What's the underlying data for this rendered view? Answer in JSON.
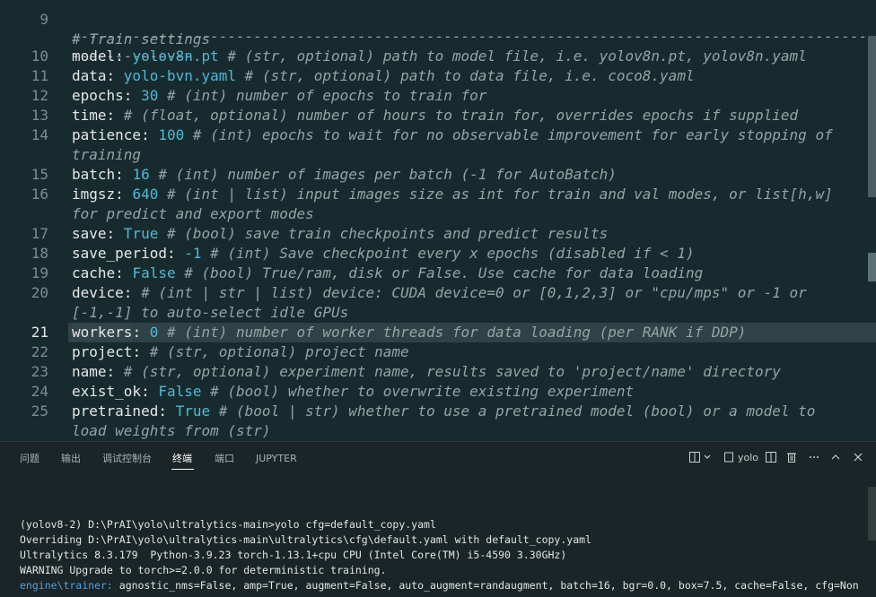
{
  "editor": {
    "top_comment": "# Train settings",
    "divider": "--------------------------------------------------------------------------------------------",
    "divider_wrap": "--------------",
    "lines": [
      {
        "num": "10",
        "key": "model",
        "value": "yolov8n.pt",
        "comment": "# (str, optional) path to model file, i.e. yolov8n.pt, yolov8n.yaml"
      },
      {
        "num": "11",
        "key": "data",
        "value": "yolo-bvn.yaml",
        "comment": "# (str, optional) path to data file, i.e. coco8.yaml"
      },
      {
        "num": "12",
        "key": "epochs",
        "value": "30",
        "comment": "# (int) number of epochs to train for"
      },
      {
        "num": "13",
        "key": "time",
        "value": "",
        "comment": "# (float, optional) number of hours to train for, overrides epochs if supplied"
      },
      {
        "num": "14",
        "key": "patience",
        "value": "100",
        "comment": "# (int) epochs to wait for no observable improvement for early stopping of",
        "wrap": "training"
      },
      {
        "num": "15",
        "key": "batch",
        "value": "16",
        "comment": "# (int) number of images per batch (-1 for AutoBatch)"
      },
      {
        "num": "16",
        "key": "imgsz",
        "value": "640",
        "comment": "# (int | list) input images size as int for train and val modes, or list[h,w]",
        "wrap": "for predict and export modes"
      },
      {
        "num": "17",
        "key": "save",
        "value": "True",
        "comment": "# (bool) save train checkpoints and predict results"
      },
      {
        "num": "18",
        "key": "save_period",
        "value": "-1",
        "comment": "# (int) Save checkpoint every x epochs (disabled if < 1)"
      },
      {
        "num": "19",
        "key": "cache",
        "value": "False",
        "comment": "# (bool) True/ram, disk or False. Use cache for data loading"
      },
      {
        "num": "20",
        "key": "device",
        "value": "",
        "comment": "# (int | str | list) device: CUDA device=0 or [0,1,2,3] or \"cpu/mps\" or -1 or",
        "wrap": "[-1,-1] to auto-select idle GPUs"
      },
      {
        "num": "21",
        "key": "workers",
        "value": "0",
        "comment": "# (int) number of worker threads for data loading (per RANK if DDP)"
      },
      {
        "num": "22",
        "key": "project",
        "value": "",
        "comment": "# (str, optional) project name"
      },
      {
        "num": "23",
        "key": "name",
        "value": "",
        "comment": "# (str, optional) experiment name, results saved to 'project/name' directory"
      },
      {
        "num": "24",
        "key": "exist_ok",
        "value": "False",
        "comment": "# (bool) whether to overwrite existing experiment"
      },
      {
        "num": "25",
        "key": "pretrained",
        "value": "True",
        "comment": "# (bool | str) whether to use a pretrained model (bool) or a model to",
        "wrap": "load weights from (str)"
      }
    ]
  },
  "panel": {
    "tabs": [
      "问题",
      "输出",
      "调试控制台",
      "终端",
      "端口",
      "JUPYTER"
    ],
    "terminal_name": "yolo",
    "terminal_lines": [
      {
        "prefix": "",
        "text": "(yolov8-2) D:\\PrAI\\yolo\\ultralytics-main>yolo cfg=default_copy.yaml"
      },
      {
        "prefix": "",
        "text": "Overriding D:\\PrAI\\yolo\\ultralytics-main\\ultralytics\\cfg\\default.yaml with default_copy.yaml"
      },
      {
        "prefix": "",
        "text": "Ultralytics 8.3.179  Python-3.9.23 torch-1.13.1+cpu CPU (Intel Core(TM) i5-4590 3.30GHz)"
      },
      {
        "prefix": "",
        "text": "WARNING Upgrade to torch>=2.0.0 for deterministic training."
      },
      {
        "prefix": "engine\\trainer:",
        "text": " agnostic_nms=False, amp=True, augment=False, auto_augment=randaugment, batch=16, bgr=0.0, box=7.5, cache=False, cfg=Non"
      }
    ]
  },
  "icons": {
    "split": "split-terminal-icon",
    "dropdown": "chevron-down-icon",
    "trash": "trash-icon",
    "more": "more-icon",
    "maximize": "chevron-up-icon",
    "close": "close-icon"
  }
}
